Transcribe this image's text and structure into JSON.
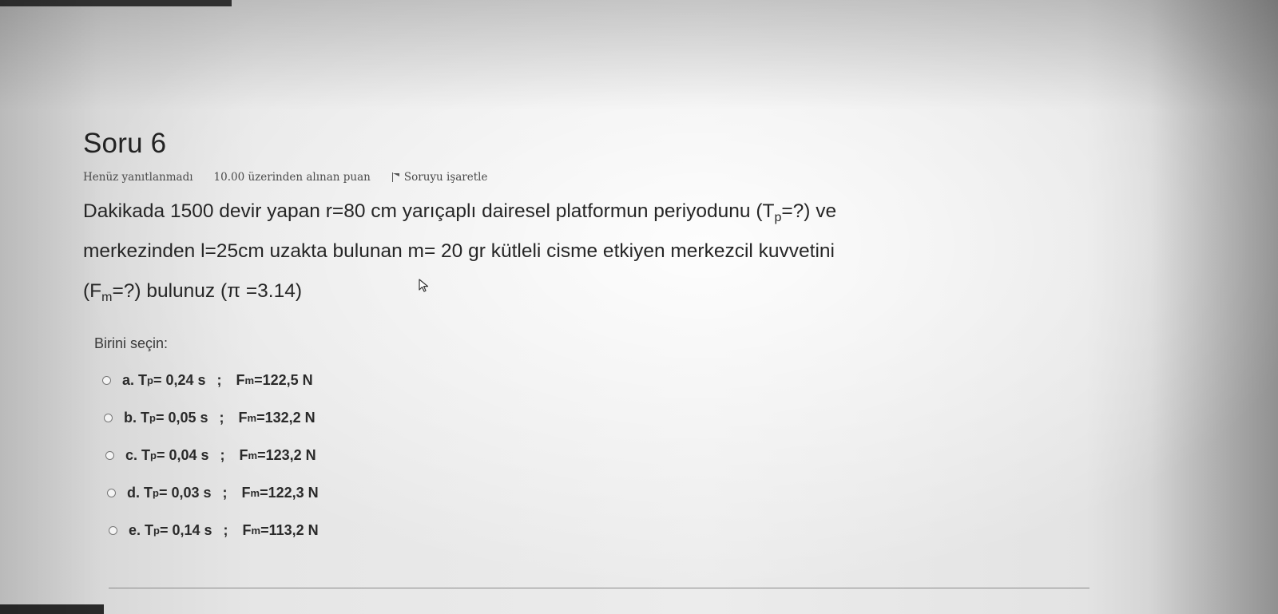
{
  "question": {
    "title": "Soru 6",
    "status": "Henüz yanıtlanmadı",
    "points": "10.00 üzerinden alınan puan",
    "flag_label": "Soruyu işaretle",
    "text": {
      "line1_a": "Dakikada 1500 devir yapan  r=80 cm  yarıçaplı dairesel platformun periyodunu (T",
      "line1_sub": "p",
      "line1_b": "=?) ve",
      "line2": "merkezinden  l=25cm uzakta bulunan  m= 20 gr kütleli cisme etkiyen merkezcil kuvvetini",
      "line3_a": "(F",
      "line3_sub": "m",
      "line3_b": "=?) bulunuz (π =3.14)"
    }
  },
  "answers": {
    "prompt": "Birini seçin:",
    "options": [
      {
        "letter": "a.",
        "t_prefix": "T",
        "t_sub": "p",
        "t_value": "= 0,24 s",
        "sep": ";",
        "f_prefix": "F",
        "f_sub": "m",
        "f_value": "=122,5 N"
      },
      {
        "letter": "b.",
        "t_prefix": "T",
        "t_sub": "p",
        "t_value": "= 0,05 s",
        "sep": ";",
        "f_prefix": "F",
        "f_sub": "m",
        "f_value": "=132,2 N"
      },
      {
        "letter": "c.",
        "t_prefix": "T",
        "t_sub": "p",
        "t_value": "= 0,04 s",
        "sep": ";",
        "f_prefix": "F",
        "f_sub": "m",
        "f_value": "=123,2 N"
      },
      {
        "letter": "d.",
        "t_prefix": "T",
        "t_sub": "p",
        "t_value": "= 0,03 s",
        "sep": ";",
        "f_prefix": "F",
        "f_sub": "m",
        "f_value": "=122,3 N"
      },
      {
        "letter": "e.",
        "t_prefix": "T",
        "t_sub": "p",
        "t_value": "= 0,14 s",
        "sep": ";",
        "f_prefix": "F",
        "f_sub": "m",
        "f_value": "=113,2 N"
      }
    ]
  },
  "icons": {
    "flag": "flag-icon",
    "cursor": "mouse-pointer-icon",
    "radio": "radio-button-icon"
  },
  "colors": {
    "text": "#262626",
    "meta": "#4a4a4a",
    "background": "#ececec"
  }
}
